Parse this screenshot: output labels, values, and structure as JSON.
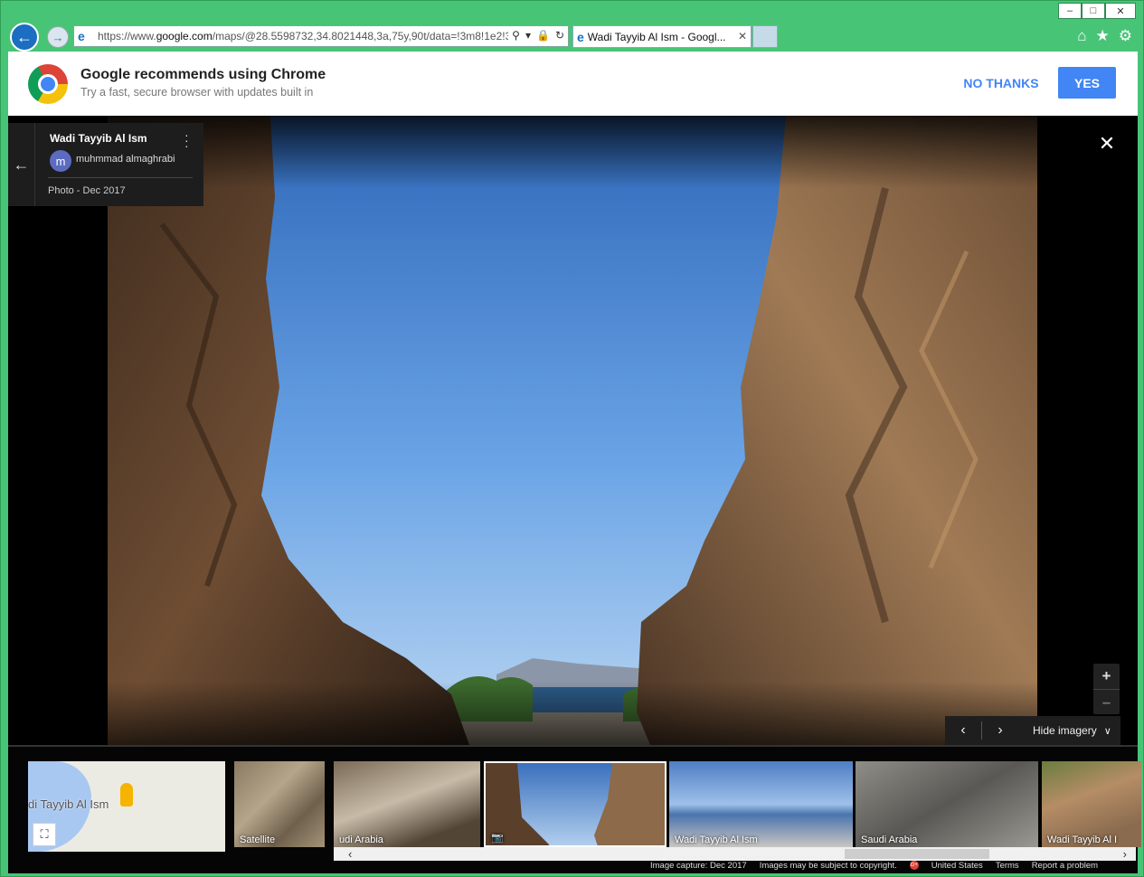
{
  "browser": {
    "url_prefix": "https://www.",
    "url_host": "google.com",
    "url_path": "/maps/@28.5598732,34.8021448,3a,75y,90t/data=!3m8!1e2!3r",
    "tab_title": "Wadi Tayyib Al Ism - Googl...",
    "icons": {
      "back": "back-arrow-icon",
      "forward": "forward-arrow-icon",
      "home": "home-icon",
      "favorites": "star-icon",
      "settings": "gear-icon"
    }
  },
  "banner": {
    "title": "Google recommends using Chrome",
    "subtitle": "Try a fast, secure browser with updates built in",
    "no_thanks": "NO THANKS",
    "yes": "YES"
  },
  "viewer": {
    "place_title": "Wadi Tayyib Al Ism",
    "author_initial": "m",
    "author_name": "muhmmad almaghrabi",
    "photo_date": "Photo - Dec 2017",
    "hide_imagery": "Hide imagery"
  },
  "filmstrip": {
    "map_label": "di Tayyib Al Ism",
    "satellite_label": "Satellite",
    "thumbs": [
      {
        "label": "udi Arabia"
      },
      {
        "label": ""
      },
      {
        "label": "Wadi Tayyib Al Ism"
      },
      {
        "label": "Saudi Arabia"
      },
      {
        "label": "Wadi Tayyib Al I"
      }
    ]
  },
  "footer": {
    "capture": "Image capture: Dec 2017",
    "copyright": "Images may be subject to copyright.",
    "country": "United States",
    "terms": "Terms",
    "report": "Report a problem"
  },
  "colors": {
    "window_frame": "#48c476",
    "chrome_blue": "#4285f4",
    "viewer_bg": "#000000"
  }
}
